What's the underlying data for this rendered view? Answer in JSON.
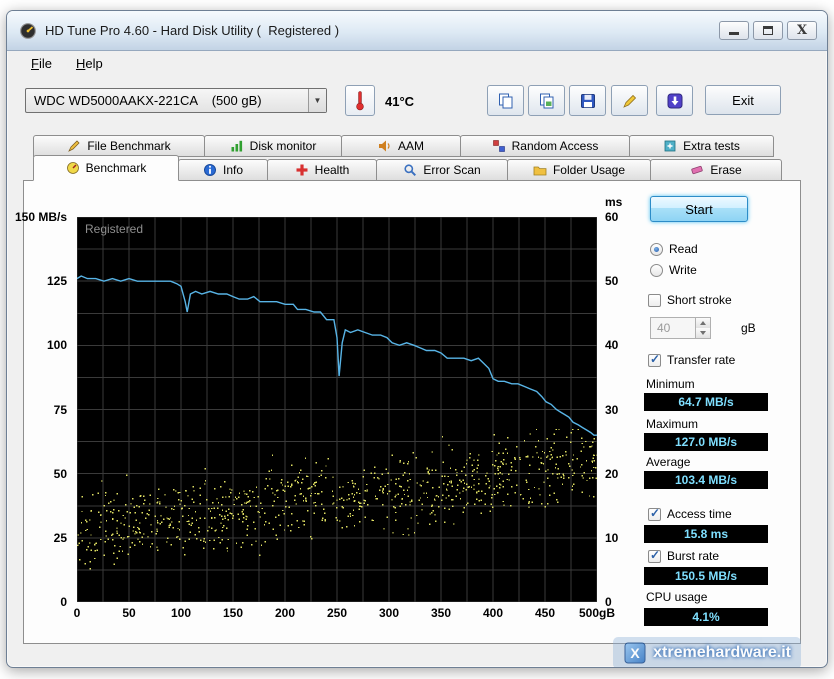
{
  "window": {
    "title": "HD Tune Pro 4.60 - Hard Disk Utility (  Registered )",
    "menu": {
      "file": "File",
      "help": "Help"
    }
  },
  "toolbar": {
    "drive": "WDC WD5000AAKX-221CA    (500 gB)",
    "temperature": "41°C",
    "exit": "Exit"
  },
  "tabs": {
    "row1": [
      {
        "label": "File Benchmark"
      },
      {
        "label": "Disk monitor"
      },
      {
        "label": "AAM"
      },
      {
        "label": "Random Access"
      },
      {
        "label": "Extra tests"
      }
    ],
    "row2": [
      {
        "label": "Benchmark",
        "selected": true
      },
      {
        "label": "Info"
      },
      {
        "label": "Health"
      },
      {
        "label": "Error Scan"
      },
      {
        "label": "Folder Usage"
      },
      {
        "label": "Erase"
      }
    ]
  },
  "panel": {
    "start": "Start",
    "read": "Read",
    "write": "Write",
    "read_selected": true,
    "write_selected": false,
    "short_stroke": "Short stroke",
    "short_stroke_checked": false,
    "short_stroke_value": "40",
    "short_stroke_unit": "gB",
    "transfer_rate": "Transfer rate",
    "transfer_rate_checked": true,
    "minimum_label": "Minimum",
    "minimum_value": "64.7 MB/s",
    "maximum_label": "Maximum",
    "maximum_value": "127.0 MB/s",
    "average_label": "Average",
    "average_value": "103.4 MB/s",
    "access_time": "Access time",
    "access_time_checked": true,
    "access_time_value": "15.8 ms",
    "burst_rate": "Burst rate",
    "burst_rate_checked": true,
    "burst_rate_value": "150.5 MB/s",
    "cpu_usage": "CPU usage",
    "cpu_usage_value": "4.1%"
  },
  "colors": {
    "transfer_line": "#58b4e6",
    "access_dots": "#dede62",
    "grid": "#3a3a3a",
    "plot_bg": "#000000",
    "value_text": "#7fdfff"
  },
  "sitemark": {
    "text": "xtremehardware.it"
  },
  "chart_data": {
    "type": "line",
    "title": "HD Tune benchmark transfer rate and access time",
    "watermark": "Registered",
    "x_axis": {
      "min": 0,
      "max": 500,
      "tick_labels": [
        "0",
        "50",
        "100",
        "150",
        "200",
        "250",
        "300",
        "350",
        "400",
        "450",
        "500gB"
      ]
    },
    "y_left": {
      "label": "MB/s",
      "min": 0,
      "max": 150,
      "tick_labels": [
        "150 MB/s",
        "125",
        "100",
        "75",
        "50",
        "25",
        "0"
      ]
    },
    "y_right": {
      "label": "ms",
      "min": 0,
      "max": 60,
      "tick_labels": [
        "60",
        "50",
        "40",
        "30",
        "20",
        "10",
        "0"
      ]
    },
    "series": [
      {
        "name": "transfer-rate",
        "type": "line",
        "axis": "left",
        "color": "#58b4e6",
        "points": [
          [
            0,
            126
          ],
          [
            4,
            127
          ],
          [
            10,
            126
          ],
          [
            18,
            126
          ],
          [
            26,
            125
          ],
          [
            34,
            126
          ],
          [
            42,
            125
          ],
          [
            50,
            126
          ],
          [
            58,
            125
          ],
          [
            66,
            125
          ],
          [
            74,
            125
          ],
          [
            82,
            125
          ],
          [
            90,
            125
          ],
          [
            96,
            124
          ],
          [
            100,
            123
          ],
          [
            104,
            117
          ],
          [
            106,
            113
          ],
          [
            109,
            120
          ],
          [
            114,
            121
          ],
          [
            120,
            120
          ],
          [
            128,
            121
          ],
          [
            136,
            120
          ],
          [
            144,
            120
          ],
          [
            150,
            119
          ],
          [
            156,
            118
          ],
          [
            164,
            118
          ],
          [
            170,
            119
          ],
          [
            176,
            117
          ],
          [
            184,
            117
          ],
          [
            192,
            117
          ],
          [
            200,
            116
          ],
          [
            208,
            116
          ],
          [
            212,
            114
          ],
          [
            220,
            114
          ],
          [
            228,
            113
          ],
          [
            234,
            113
          ],
          [
            240,
            110
          ],
          [
            247,
            110
          ],
          [
            250,
            103
          ],
          [
            252,
            88
          ],
          [
            255,
            101
          ],
          [
            258,
            106
          ],
          [
            263,
            105
          ],
          [
            270,
            106
          ],
          [
            277,
            105
          ],
          [
            284,
            104
          ],
          [
            292,
            104
          ],
          [
            298,
            103
          ],
          [
            303,
            101
          ],
          [
            310,
            100
          ],
          [
            317,
            101
          ],
          [
            324,
            100
          ],
          [
            330,
            99
          ],
          [
            336,
            98
          ],
          [
            344,
            98
          ],
          [
            350,
            97
          ],
          [
            356,
            95
          ],
          [
            364,
            95
          ],
          [
            372,
            95
          ],
          [
            379,
            94
          ],
          [
            386,
            95
          ],
          [
            391,
            93
          ],
          [
            396,
            91
          ],
          [
            400,
            87
          ],
          [
            405,
            86
          ],
          [
            411,
            86
          ],
          [
            418,
            85
          ],
          [
            424,
            85
          ],
          [
            430,
            84
          ],
          [
            436,
            83
          ],
          [
            442,
            82
          ],
          [
            447,
            80
          ],
          [
            451,
            78
          ],
          [
            456,
            77
          ],
          [
            461,
            75
          ],
          [
            465,
            74
          ],
          [
            469,
            73
          ],
          [
            473,
            72
          ],
          [
            477,
            70
          ],
          [
            482,
            69
          ],
          [
            486,
            68
          ],
          [
            490,
            67
          ],
          [
            494,
            66
          ],
          [
            497,
            65
          ],
          [
            500,
            65
          ]
        ]
      },
      {
        "name": "access-time",
        "type": "scatter",
        "axis": "right",
        "color": "#dede62",
        "generator": {
          "seed": 20110604,
          "count": 900,
          "x_min": 0,
          "x_max": 500,
          "y_start": 11,
          "y_end": 21.5,
          "spread": 8,
          "y_min": 3.5,
          "y_max": 27
        }
      }
    ]
  }
}
